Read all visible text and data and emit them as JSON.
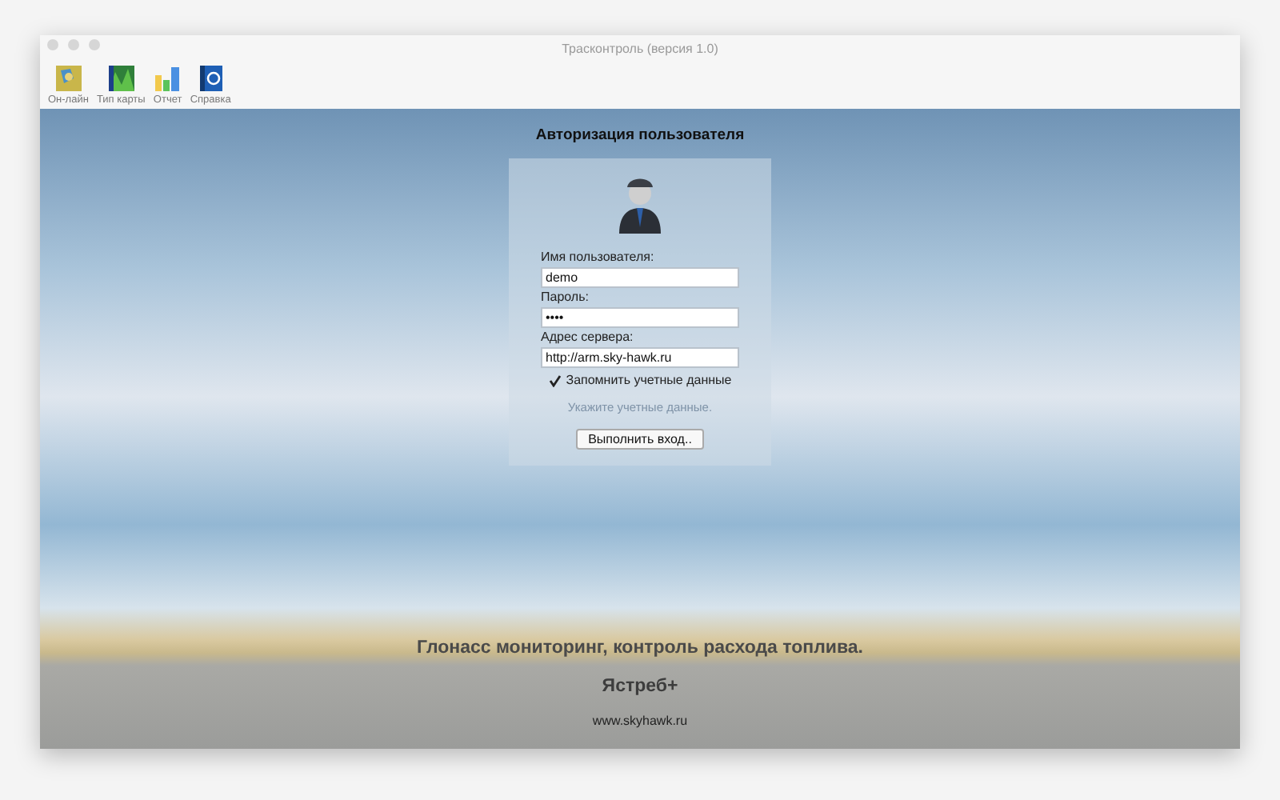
{
  "window": {
    "title": "Трасконтроль (версия 1.0)"
  },
  "toolbar": [
    {
      "label": "Он-лайн",
      "kind": "map"
    },
    {
      "label": "Тип карты",
      "kind": "terrain"
    },
    {
      "label": "Отчет",
      "kind": "chart"
    },
    {
      "label": "Справка",
      "kind": "help"
    }
  ],
  "login": {
    "title": "Авторизация пользователя",
    "fields": [
      {
        "label": "Имя пользователя:",
        "value": "demo"
      },
      {
        "label": "Пароль:",
        "value": "••••"
      },
      {
        "label": "Адрес сервера:",
        "value": "http://arm.sky-hawk.ru"
      }
    ],
    "remember": {
      "label": "Запомнить учетные данные",
      "checked": true
    },
    "hint": {
      "text": "Укажите учетные данные.",
      "disabled": true
    },
    "button": "Выполнить вход.."
  },
  "footer": {
    "slogan": "Глонасс мониторинг, контроль расхода топлива.",
    "brand": "Ястреб+",
    "url": "www.skyhawk.ru"
  }
}
